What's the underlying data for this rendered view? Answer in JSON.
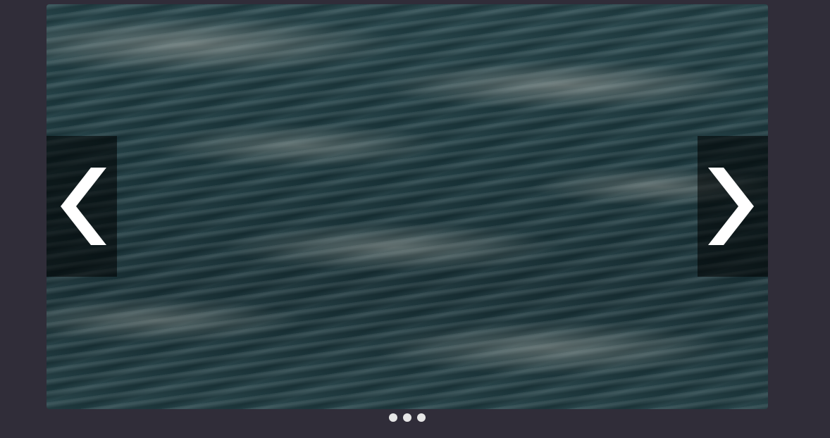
{
  "carousel": {
    "slide_image": "ocean-water-texture",
    "prev_icon": "chevron-left-icon",
    "next_icon": "chevron-right-icon",
    "slide_count": 3,
    "active_index": 0
  },
  "colors": {
    "background": "#302d39",
    "indicator": "#e6e6e6",
    "arrow": "#ffffff"
  }
}
